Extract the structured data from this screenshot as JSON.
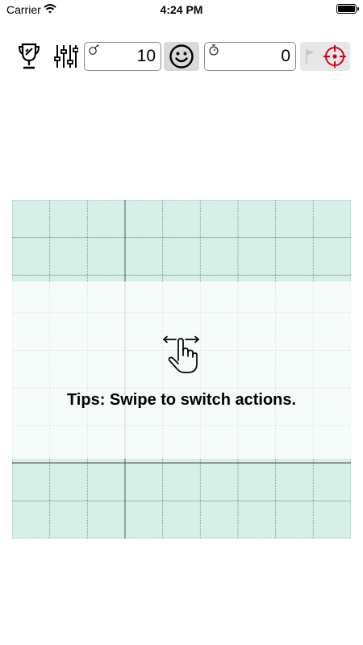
{
  "status_bar": {
    "carrier": "Carrier",
    "time": "4:24 PM"
  },
  "toolbar": {
    "trophy_icon": "trophy-icon",
    "settings_icon": "sliders-icon",
    "mine_counter": {
      "icon": "bomb-icon",
      "value": "10"
    },
    "face_icon": "smiley-face-icon",
    "timer_counter": {
      "icon": "stopwatch-icon",
      "value": "0"
    },
    "mode_icons": [
      "flag-icon",
      "crosshair-icon"
    ],
    "accent_color": "#d0021b"
  },
  "board": {
    "rows": 9,
    "columns": 9,
    "cell_color": "#d6f0e7",
    "grid_color": "#8c9a95",
    "tips": {
      "icon": "swipe-hand-icon",
      "text": "Tips: Swipe to switch actions."
    }
  }
}
